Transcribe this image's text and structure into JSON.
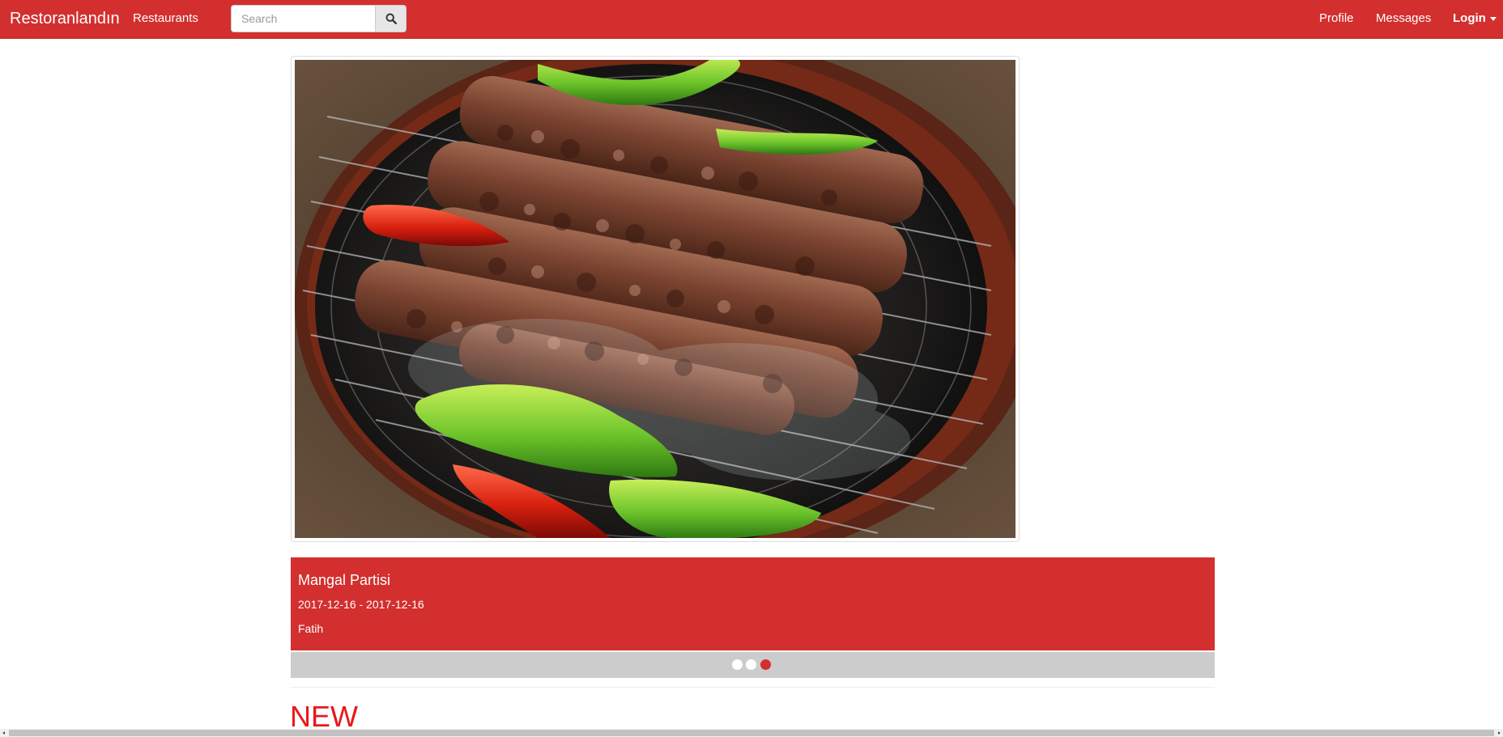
{
  "navbar": {
    "brand": "Restoranlandın",
    "links": {
      "restaurants": "Restaurants",
      "profile": "Profile",
      "messages": "Messages",
      "login": "Login"
    },
    "search": {
      "placeholder": "Search",
      "value": "",
      "icon": "search-icon"
    },
    "colors": {
      "background": "#d32f2f",
      "text": "#ffffff"
    }
  },
  "carousel": {
    "image": {
      "subject": "skewered meat kebabs and peppers on a charcoal grill"
    },
    "caption": {
      "title": "Mangal Partisi",
      "date_range": "2017-12-16 - 2017-12-16",
      "author": "Fatih"
    },
    "indicators": {
      "count": 3,
      "active_index": 2
    },
    "colors": {
      "caption_background": "#d32f2f",
      "indicator_bar": "#cccccc",
      "indicator_active": "#d32f2f",
      "indicator_inactive": "#ffffff"
    }
  },
  "sections": {
    "new_heading": "NEW",
    "heading_color": "#e8181b"
  }
}
